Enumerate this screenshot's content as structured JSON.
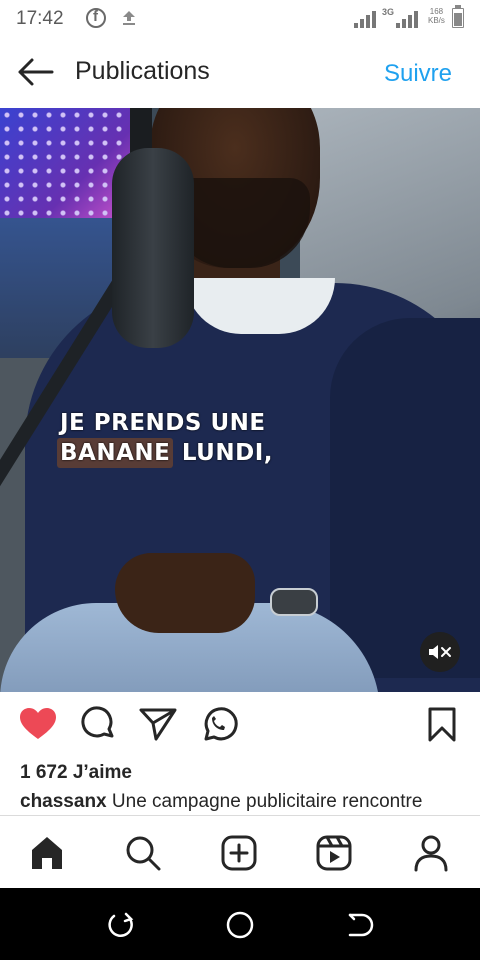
{
  "status_bar": {
    "time": "17:42",
    "network_type": "3G",
    "speed_value": "168",
    "speed_unit": "KB/s",
    "icons": [
      "facebook-icon",
      "upload-icon",
      "signal-icon",
      "signal-icon",
      "battery-icon"
    ]
  },
  "header": {
    "title": "Publications",
    "follow_label": "Suivre",
    "back_icon": "arrow-left-icon"
  },
  "media": {
    "caption_lines": [
      {
        "highlight": "",
        "text": "JE PRENDS UNE"
      },
      {
        "highlight": "BANANE",
        "text": " LUNDI,"
      }
    ],
    "mute_icon": "volume-muted-icon"
  },
  "actions": {
    "icons": [
      "heart-filled-icon",
      "comment-icon",
      "share-icon",
      "whatsapp-icon",
      "bookmark-icon"
    ]
  },
  "post": {
    "likes": "1 672 J’aime",
    "username": "chassanx",
    "caption": " Une campagne publicitaire rencontre"
  },
  "bottom_nav": {
    "items": [
      "home-icon",
      "search-icon",
      "create-icon",
      "reels-icon",
      "profile-icon"
    ]
  },
  "colors": {
    "accent": "#1fa1ef",
    "like": "#ed4956",
    "text": "#262626"
  }
}
